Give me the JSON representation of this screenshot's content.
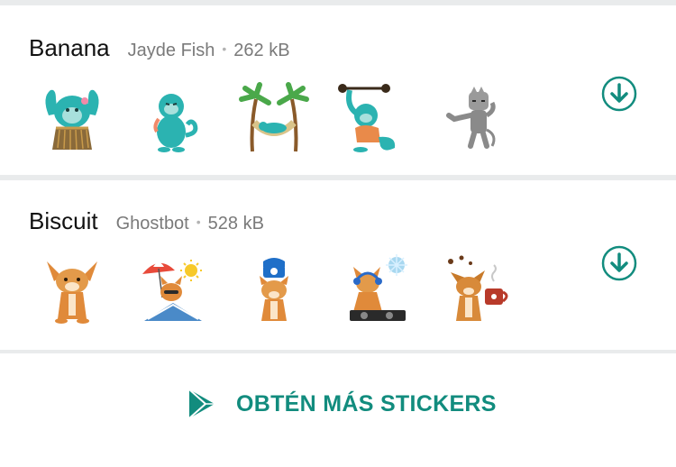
{
  "packs": [
    {
      "name": "Banana",
      "author": "Jayde Fish",
      "separator": "•",
      "size": "262 kB",
      "stickers": [
        "hula-monkey-sticker",
        "sitting-monkey-sticker",
        "hammock-monkey-sticker",
        "weightlifting-monkey-sticker",
        "gray-cat-sticker"
      ],
      "download_icon": "download-circle-icon"
    },
    {
      "name": "Biscuit",
      "author": "Ghostbot",
      "separator": "•",
      "size": "528 kB",
      "stickers": [
        "corgi-sitting-sticker",
        "corgi-beach-sticker",
        "corgi-phone-sticker",
        "corgi-dj-sticker",
        "corgi-coffee-sticker"
      ],
      "download_icon": "download-circle-icon"
    }
  ],
  "footer": {
    "label": "OBTÉN MÁS STICKERS",
    "icon": "play-store-icon"
  },
  "colors": {
    "accent": "#128c7e",
    "teal_sticker": "#2bb3b1",
    "divider": "#e9ebec"
  }
}
